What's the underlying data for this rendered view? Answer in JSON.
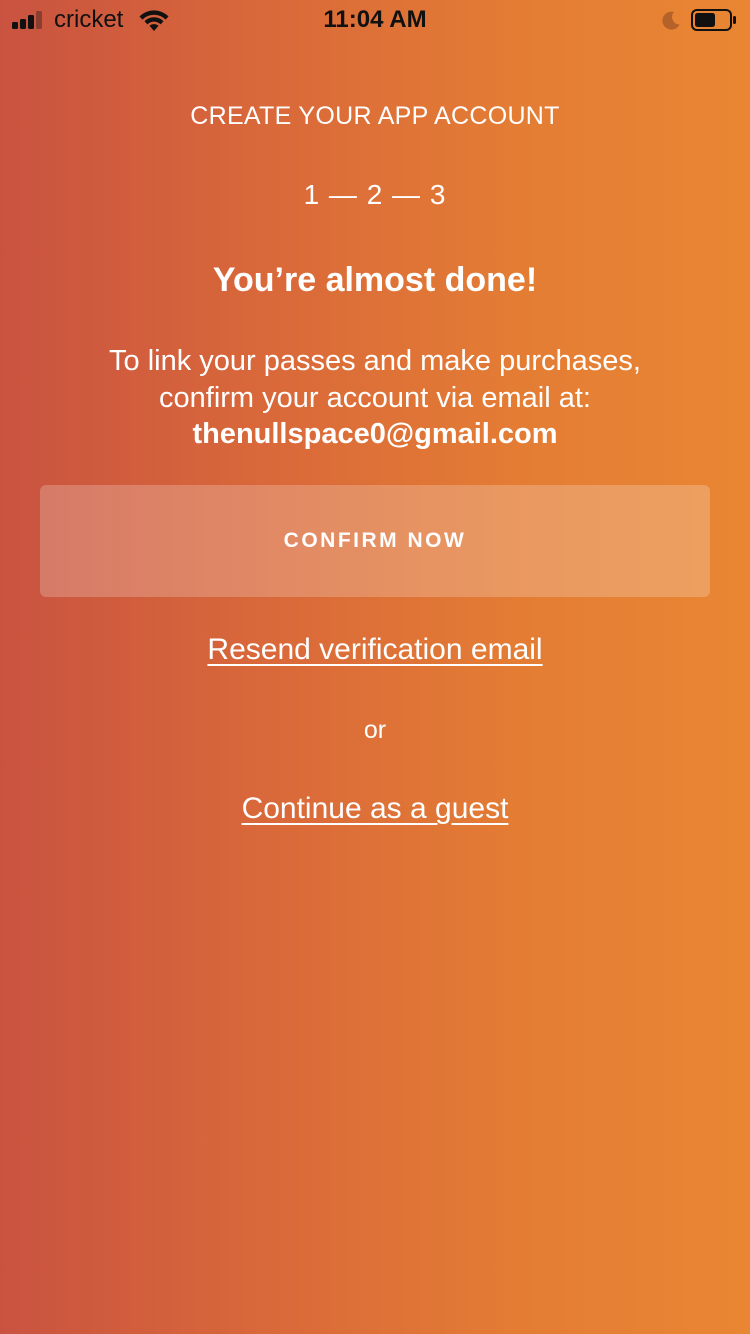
{
  "status_bar": {
    "carrier": "cricket",
    "time": "11:04 AM",
    "icons": [
      "cellular-signal-icon",
      "wifi-icon",
      "do-not-disturb-moon-icon",
      "battery-icon"
    ]
  },
  "onboarding": {
    "header_title": "CREATE YOUR APP ACCOUNT",
    "step_indicator": "1 — 2 — 3",
    "headline": "You’re almost done!",
    "message_line1": "To link your passes and make purchases,",
    "message_line2": "confirm your account via email at:",
    "email": "thenullspace0@gmail.com",
    "confirm_button_label": "CONFIRM NOW",
    "resend_link_label": "Resend verification email",
    "or_label": "or",
    "guest_link_label": "Continue as a guest"
  },
  "colors": {
    "gradient_start": "#c95340",
    "gradient_end": "#e98633",
    "text": "#ffffff",
    "battery_fill": "#111111",
    "moon": "#b5622a"
  }
}
